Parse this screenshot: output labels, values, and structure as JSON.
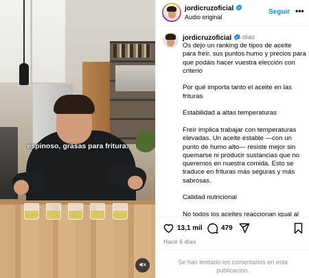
{
  "video": {
    "caption": "espinoso, grasas para fritura.",
    "mute_icon": "speaker-muted-icon"
  },
  "header": {
    "username": "jordicruzoficial",
    "verified_icon": "verified-badge-icon",
    "subtitle": "Audio original",
    "follow_label": "Seguir",
    "more_label": "•••"
  },
  "post": {
    "username": "jordicruzoficial",
    "time_ago": "6 días",
    "paragraphs": [
      "Os dejo un ranking de tipos de aceite para freír, sus puntos humo y precios para que podáis hacer vuestra elección con criterio",
      "Por qué importa tanto el aceite en las frituras",
      "Estabilidad a altas temperaturas",
      "Freír implica trabajar con temperaturas elevadas. Un aceite estable —con un punto de humo alto— resiste mejor sin quemarse ni producir sustancias que no queremos en nuestra comida. Esto se traduce en frituras más seguras y más sabrosas.",
      "Calidad nutricional",
      "No todos los aceites reaccionan igual al"
    ]
  },
  "actions": {
    "likes": "13,1 mil",
    "comments": "479",
    "date": "Hace 6 días",
    "comments_limited": "Se han limitado los comentarios en esta publicación."
  },
  "colors": {
    "accent": "#0095f6",
    "verified": "#0095f6",
    "muted_text": "#737373"
  }
}
